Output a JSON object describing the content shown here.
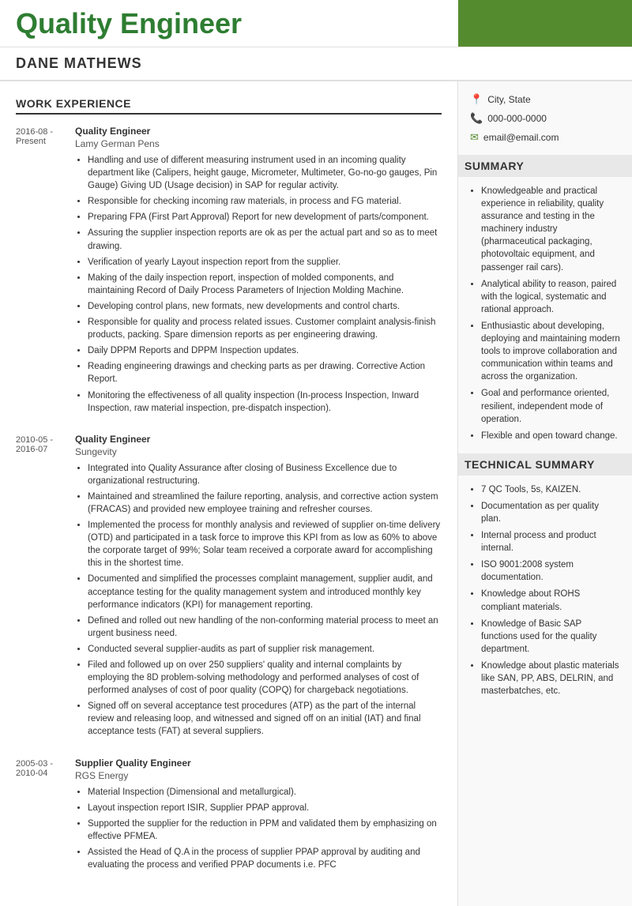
{
  "header": {
    "title": "Quality Engineer",
    "accent_color": "#558b2f"
  },
  "name": "DANE MATHEWS",
  "contact": {
    "location": "City, State",
    "phone": "000-000-0000",
    "email": "email@email.com"
  },
  "sections": {
    "work_experience_title": "WORK EXPERIENCE",
    "summary_title": "SUMMARY",
    "technical_title": "TECHNICAL SUMMARY"
  },
  "work_experience": [
    {
      "date": "2016-08 -\nPresent",
      "title": "Quality Engineer",
      "company": "Lamy German Pens",
      "bullets": [
        "Handling and use of different measuring instrument used in an incoming quality department like (Calipers, height gauge, Micrometer, Multimeter, Go-no-go gauges, Pin Gauge) Giving UD (Usage decision) in SAP for regular activity.",
        "Responsible for checking incoming raw materials, in process and FG material.",
        "Preparing FPA (First Part Approval) Report for new development of parts/component.",
        "Assuring the supplier inspection reports are ok as per the actual part and so as to meet drawing.",
        "Verification of yearly Layout inspection report from the supplier.",
        "Making of the daily inspection report, inspection of molded components, and maintaining Record of Daily Process Parameters of Injection Molding Machine.",
        "Developing control plans, new formats, new developments and control charts.",
        "Responsible for quality and process related issues. Customer complaint analysis-finish products, packing. Spare dimension reports as per engineering drawing.",
        "Daily DPPM Reports and DPPM Inspection updates.",
        "Reading engineering drawings and checking parts as per drawing. Corrective Action Report.",
        "Monitoring the effectiveness of all quality inspection (In-process Inspection, Inward Inspection, raw material inspection, pre-dispatch inspection)."
      ]
    },
    {
      "date": "2010-05 -\n2016-07",
      "title": "Quality Engineer",
      "company": "Sungevity",
      "bullets": [
        "Integrated into Quality Assurance after closing of Business Excellence due to organizational restructuring.",
        "Maintained and streamlined the failure reporting, analysis, and corrective action system (FRACAS) and provided new employee training and refresher courses.",
        "Implemented the process for monthly analysis and reviewed of supplier on-time delivery (OTD) and participated in a task force to improve this KPI from as low as 60% to above the corporate target of 99%; Solar team received a corporate award for accomplishing this in the shortest time.",
        "Documented and simplified the processes complaint management, supplier audit, and acceptance testing for the quality management system and introduced monthly key performance indicators (KPI) for management reporting.",
        "Defined and rolled out new handling of the non-conforming material process to meet an urgent business need.",
        "Conducted several supplier-audits as part of supplier risk management.",
        "Filed and followed up on over 250 suppliers' quality and internal complaints by employing the 8D problem-solving methodology and performed analyses of cost of performed analyses of cost of poor quality (COPQ) for chargeback negotiations.",
        "Signed off on several acceptance test procedures (ATP) as the part of the internal review and releasing loop, and witnessed and signed off on an initial (IAT) and final acceptance tests (FAT) at several suppliers."
      ]
    },
    {
      "date": "2005-03 -\n2010-04",
      "title": "Supplier Quality Engineer",
      "company": "RGS Energy",
      "bullets": [
        "Material Inspection (Dimensional and metallurgical).",
        "Layout inspection report ISIR, Supplier PPAP approval.",
        "Supported the supplier for the reduction in PPM and validated them by emphasizing on effective PFMEA.",
        "Assisted the Head of Q.A in the process of supplier PPAP approval by auditing and evaluating the process and verified PPAP documents i.e. PFC"
      ]
    }
  ],
  "summary": [
    "Knowledgeable and practical experience in reliability, quality assurance and testing in the machinery industry (pharmaceutical packaging, photovoltaic equipment, and passenger rail cars).",
    "Analytical ability to reason, paired with the logical, systematic and rational approach.",
    "Enthusiastic about developing, deploying and maintaining modern tools to improve collaboration and communication within teams and across the organization.",
    "Goal and performance oriented, resilient, independent mode of operation.",
    "Flexible and open toward change."
  ],
  "technical": [
    "7 QC Tools, 5s, KAIZEN.",
    "Documentation as per quality plan.",
    "Internal process and product internal.",
    "ISO 9001:2008 system documentation.",
    "Knowledge about ROHS compliant materials.",
    "Knowledge of Basic SAP functions used for the quality department.",
    "Knowledge about plastic materials like SAN, PP, ABS, DELRIN, and masterbatches, etc."
  ]
}
